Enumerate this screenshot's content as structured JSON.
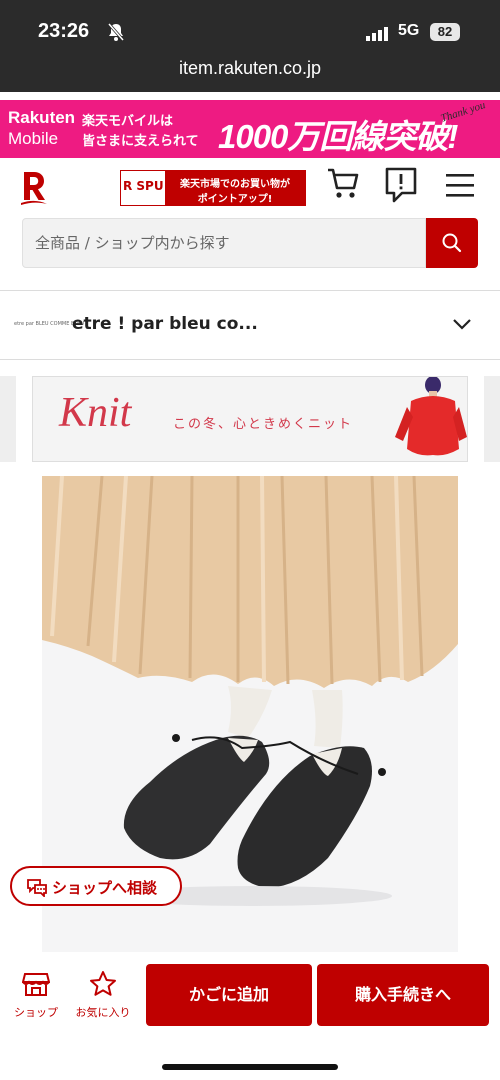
{
  "status_bar": {
    "time": "23:26",
    "network": "5G",
    "battery": "82"
  },
  "browser": {
    "url": "item.rakuten.co.jp"
  },
  "promo": {
    "brand_line1": "Rakuten",
    "brand_line2": "Mobile",
    "line1": "楽天モバイルは",
    "line2": "皆さまに支えられて",
    "headline": "1000万回線突破!",
    "thanks": "Thank you",
    "color": "#ee1b82"
  },
  "header": {
    "spu_label": "R SPU!",
    "spu_line1": "楽天市場でのお買い物が",
    "spu_line2": "ポイントアップ!"
  },
  "search": {
    "placeholder": "全商品 / ショップ内から探す"
  },
  "shop": {
    "logo_text": "etre par BLEU COMME BLEU",
    "name": "etre ! par bleu co..."
  },
  "knit_banner": {
    "title": "Knit",
    "subtitle": "この冬、心ときめくニット"
  },
  "chat": {
    "label": "ショップへ相談"
  },
  "bottom_bar": {
    "shop_label": "ショップ",
    "favorite_label": "お気に入り",
    "add_to_cart": "かごに追加",
    "checkout": "購入手続きへ"
  },
  "colors": {
    "brand_red": "#bf0000",
    "knit_red": "#d2384a"
  },
  "icons": [
    "mute-icon",
    "signal-icon",
    "cart-icon",
    "notice-icon",
    "menu-icon",
    "search-icon",
    "chevron-down-icon",
    "chat-icon",
    "shop-icon",
    "star-icon"
  ]
}
